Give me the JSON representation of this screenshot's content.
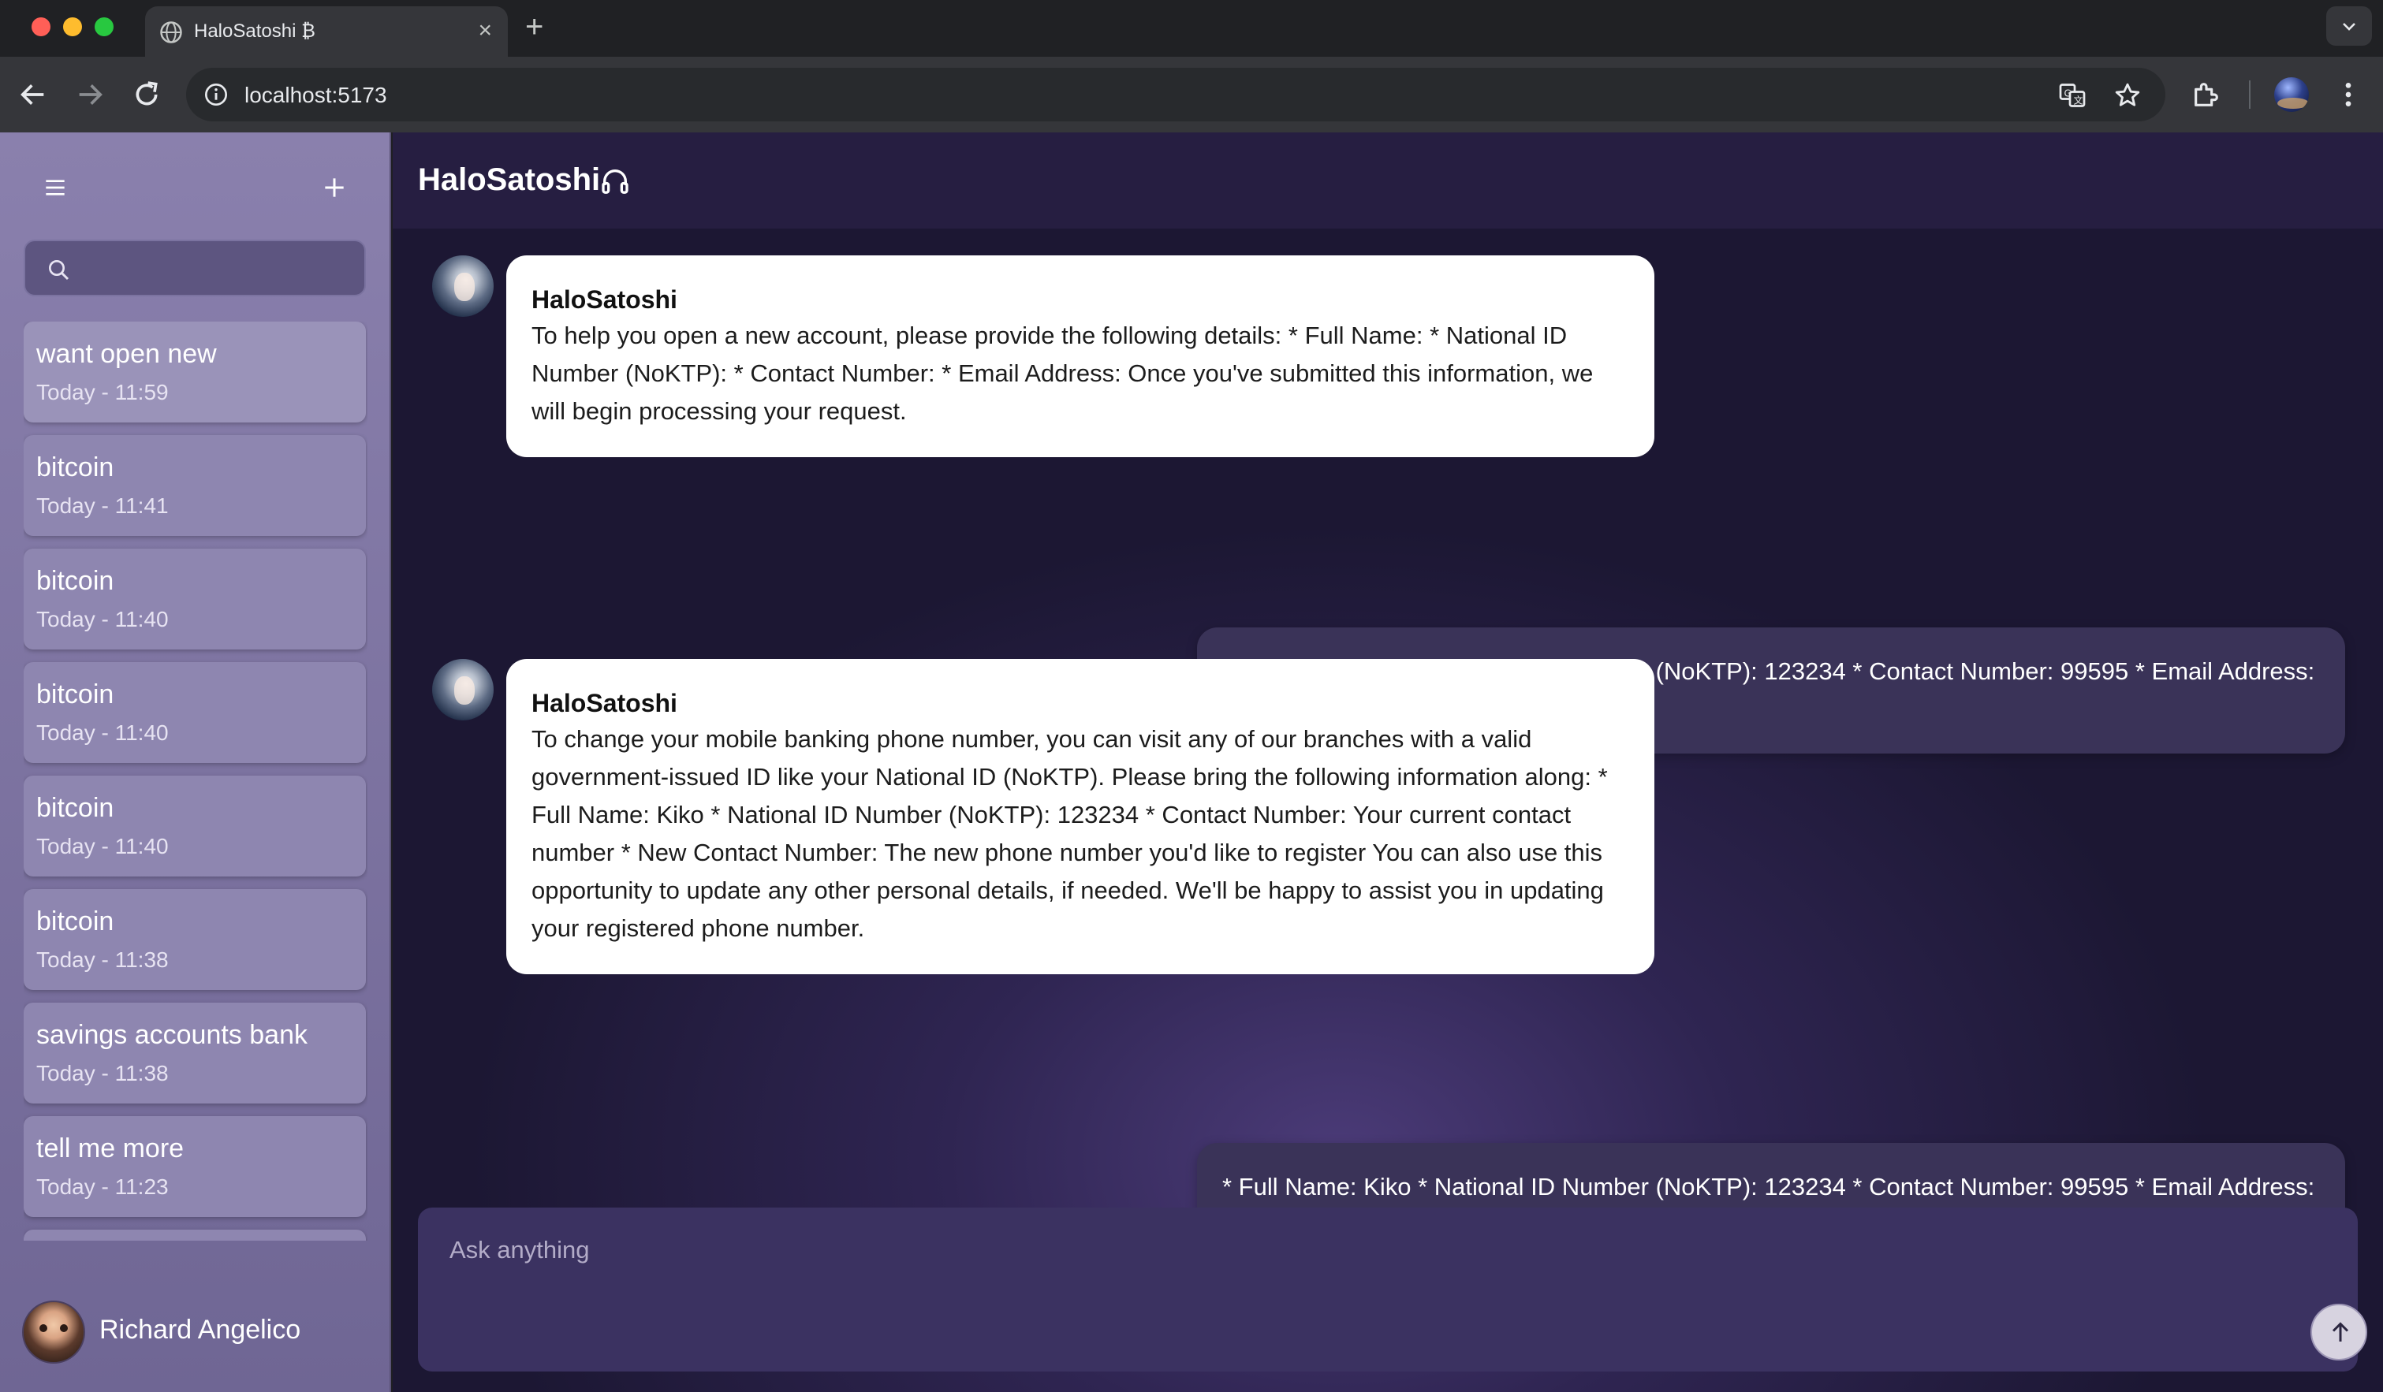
{
  "browser": {
    "tab_title": "HaloSatoshi ₿",
    "url": "localhost:5173"
  },
  "sidebar": {
    "search_placeholder": "",
    "conversations": [
      {
        "title": "want open new",
        "time": "Today - 11:59"
      },
      {
        "title": "bitcoin",
        "time": "Today - 11:41"
      },
      {
        "title": "bitcoin",
        "time": "Today - 11:40"
      },
      {
        "title": "bitcoin",
        "time": "Today - 11:40"
      },
      {
        "title": "bitcoin",
        "time": "Today - 11:40"
      },
      {
        "title": "bitcoin",
        "time": "Today - 11:38"
      },
      {
        "title": "savings accounts bank",
        "time": "Today - 11:38"
      },
      {
        "title": "tell me more",
        "time": "Today - 11:23"
      }
    ],
    "user_name": "Richard Angelico"
  },
  "header": {
    "title": "HaloSatoshi"
  },
  "messages": [
    {
      "role": "bot",
      "name": "HaloSatoshi",
      "text": "To help you open a new account, please provide the following details: * Full Name: * National ID Number (NoKTP): * Contact Number: * Email Address: Once you've submitted this information, we will begin processing your request."
    },
    {
      "role": "user",
      "text": "* Full Name: Kiko * National ID Number (NoKTP): 123234 * Contact Number: 99595 * Email Address: mantap@gmail.com"
    },
    {
      "role": "bot",
      "name": "HaloSatoshi",
      "text": "To change your mobile banking phone number, you can visit any of our branches with a valid government-issued ID like your National ID (NoKTP). Please bring the following information along: * Full Name: Kiko * National ID Number (NoKTP): 123234 * Contact Number: Your current contact number * New Contact Number: The new phone number you'd like to register You can also use this opportunity to update any other personal details, if needed. We'll be happy to assist you in updating your registered phone number."
    },
    {
      "role": "user",
      "text": "* Full Name: Kiko * National ID Number (NoKTP): 123234 * Contact Number: 99595 * Email Address: mantap@gmail.com"
    },
    {
      "role": "bot",
      "name": "",
      "text": ""
    }
  ],
  "composer": {
    "placeholder": "Ask anything"
  },
  "icons": {
    "tab_favicon": "globe-icon",
    "menu": "hamburger-icon",
    "new_chat": "plus-icon",
    "search": "search-icon",
    "headset": "headset-icon",
    "send": "arrow-up-icon"
  },
  "colors": {
    "sidebar_bg": "#8a80ad",
    "main_bg": "#2f2552",
    "bot_bubble": "#ffffff",
    "user_bubble": "#3a3358"
  }
}
